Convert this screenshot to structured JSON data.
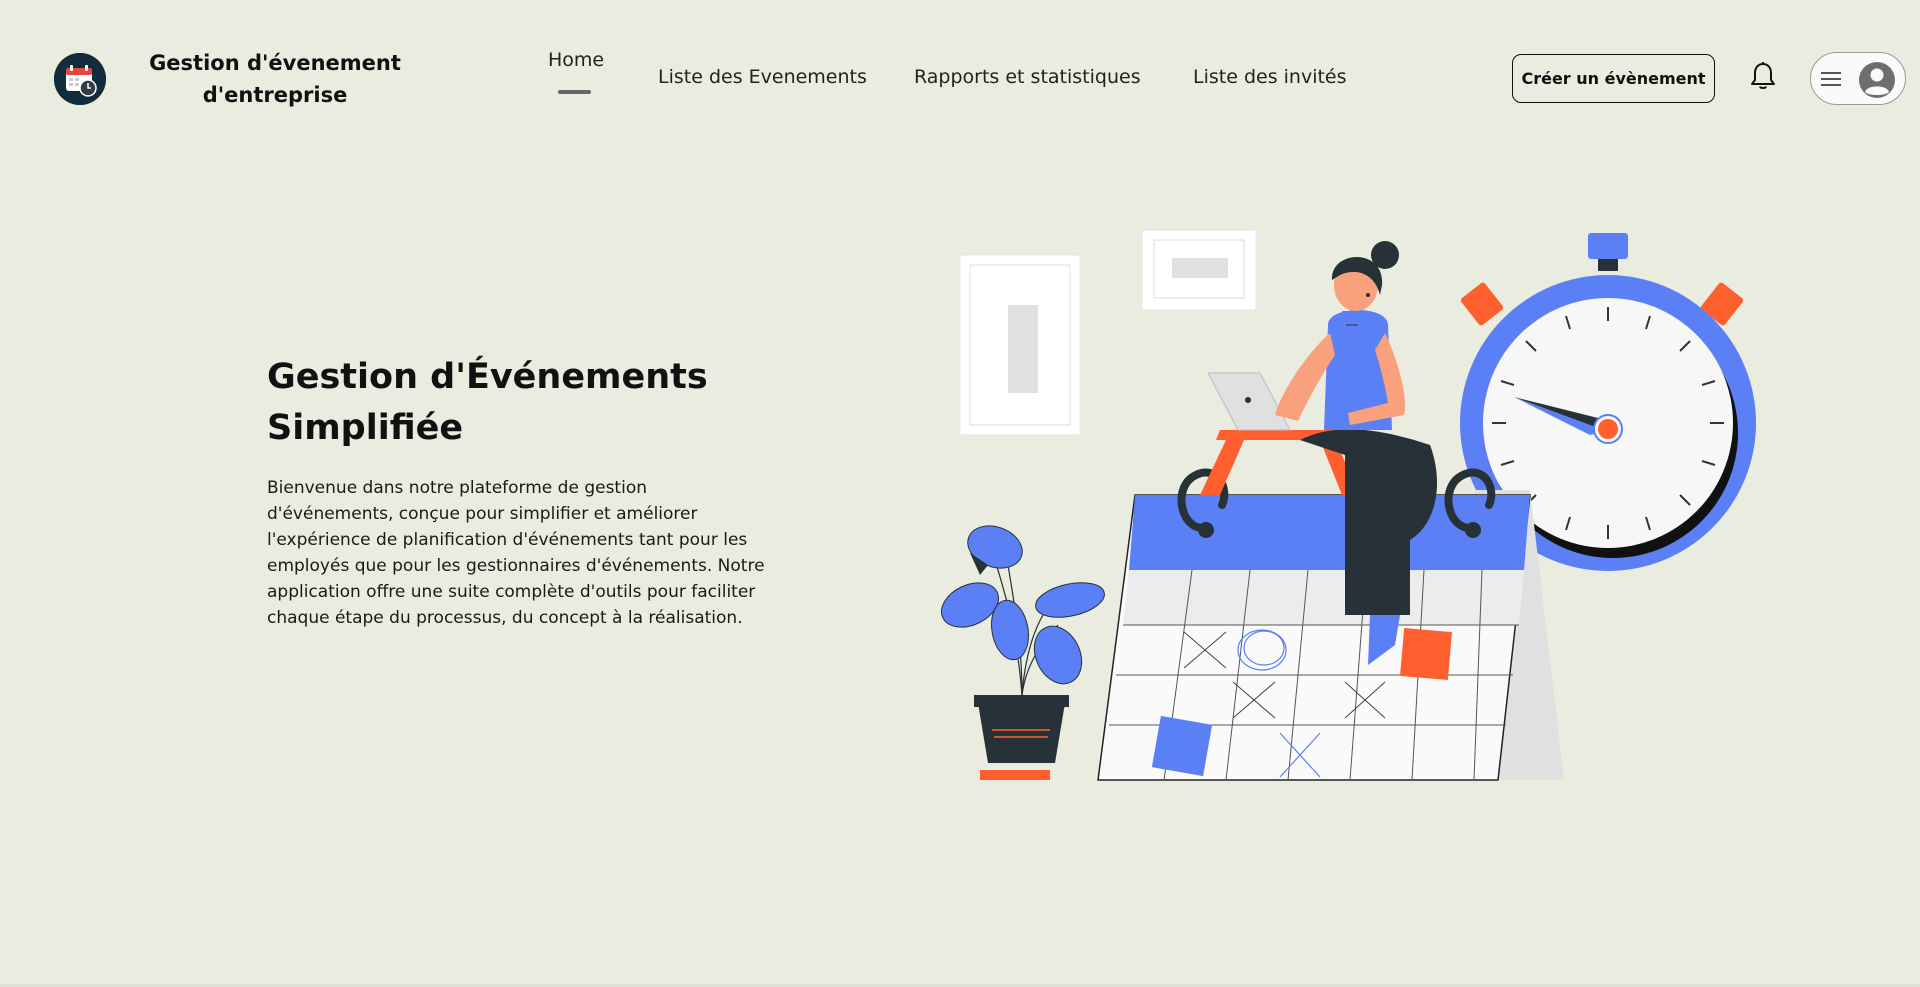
{
  "header": {
    "brand_title": "Gestion d'évenement d'entreprise",
    "nav": [
      {
        "label": "Home",
        "active": true
      },
      {
        "label": "Liste des Evenements",
        "active": false
      },
      {
        "label": "Rapports et statistiques",
        "active": false
      },
      {
        "label": "Liste des invités",
        "active": false
      }
    ],
    "create_button_label": "Créer un évènement",
    "icons": {
      "logo": "calendar-clock-icon",
      "notifications": "bell-icon",
      "menu": "hamburger-icon",
      "user": "user-avatar-icon"
    }
  },
  "hero": {
    "title": "Gestion d'Événements Simplifiée",
    "description": "Bienvenue dans notre plateforme de gestion d'événements, conçue pour simplifier et améliorer l'expérience de planification d'événements tant pour les employés que pour les gestionnaires d'événements. Notre application offre une suite complète d'outils pour faciliter chaque étape du processus, du concept à la réalisation."
  },
  "colors": {
    "background": "#e9ecdf",
    "accent_blue": "#5b7ff5",
    "accent_orange": "#ff5f2e",
    "dark": "#263238"
  }
}
